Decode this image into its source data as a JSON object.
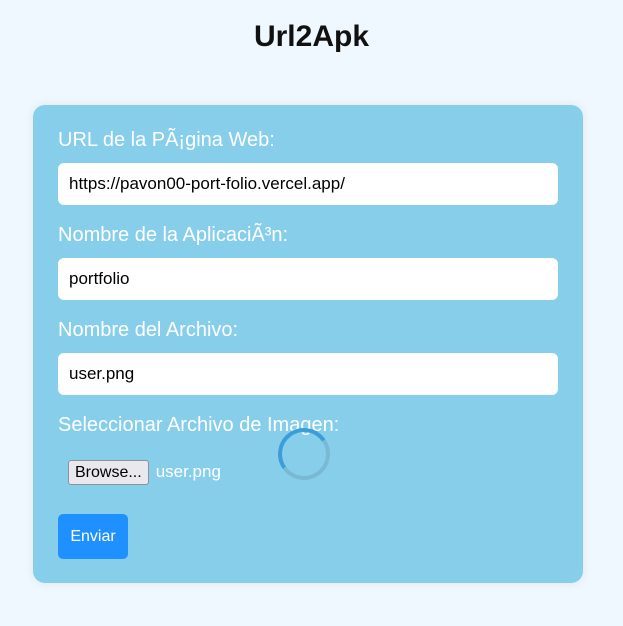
{
  "app": {
    "title": "Url2Apk"
  },
  "form": {
    "url_label": "URL de la PÃ¡gina Web:",
    "url_value": "https://pavon00-port-folio.vercel.app/",
    "app_name_label": "Nombre de la AplicaciÃ³n:",
    "app_name_value": "portfolio",
    "file_name_label": "Nombre del Archivo:",
    "file_name_value": "user.png",
    "image_label": "Seleccionar Archivo de Imagen:",
    "browse_label": "Browse...",
    "selected_file": "user.png",
    "submit_label": "Enviar"
  },
  "colors": {
    "background": "#f0f8ff",
    "card": "#87ceeb",
    "submit_button": "#1e90ff",
    "spinner_accent": "#3b9ed8"
  },
  "status": {
    "loading_spinner": "spinner-icon"
  }
}
